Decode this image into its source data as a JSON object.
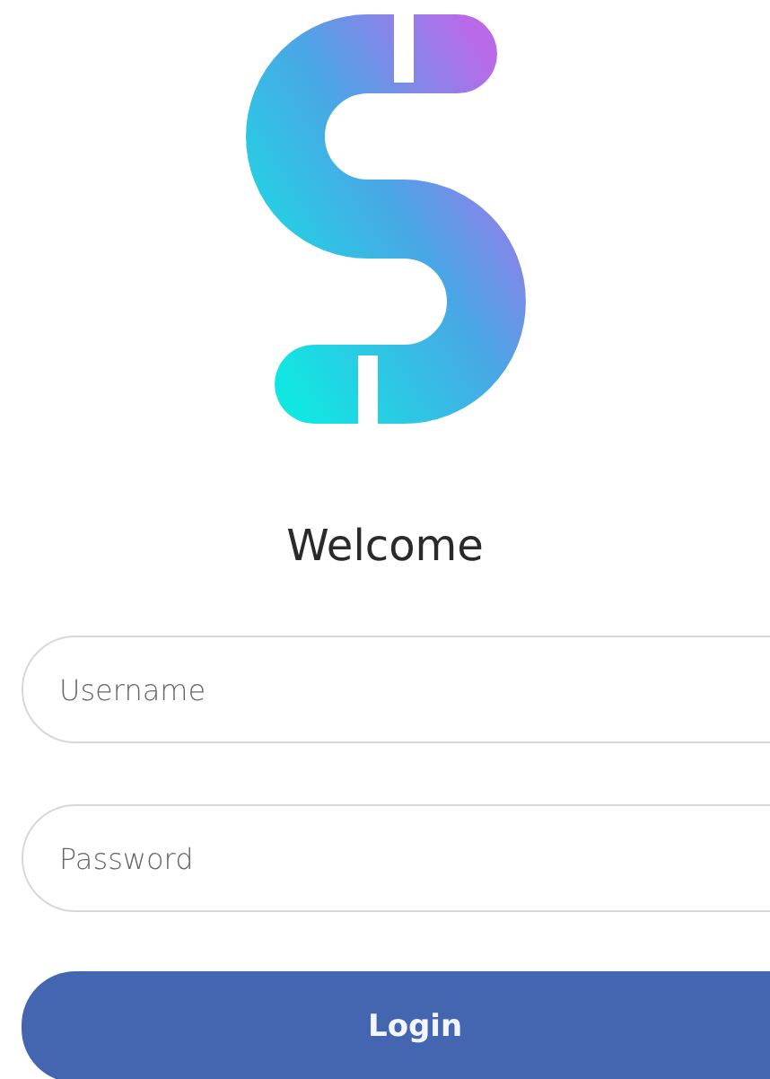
{
  "heading": "Welcome",
  "fields": [
    {
      "placeholder": "Username"
    },
    {
      "placeholder": "Password"
    }
  ],
  "button": {
    "label": "Login"
  }
}
